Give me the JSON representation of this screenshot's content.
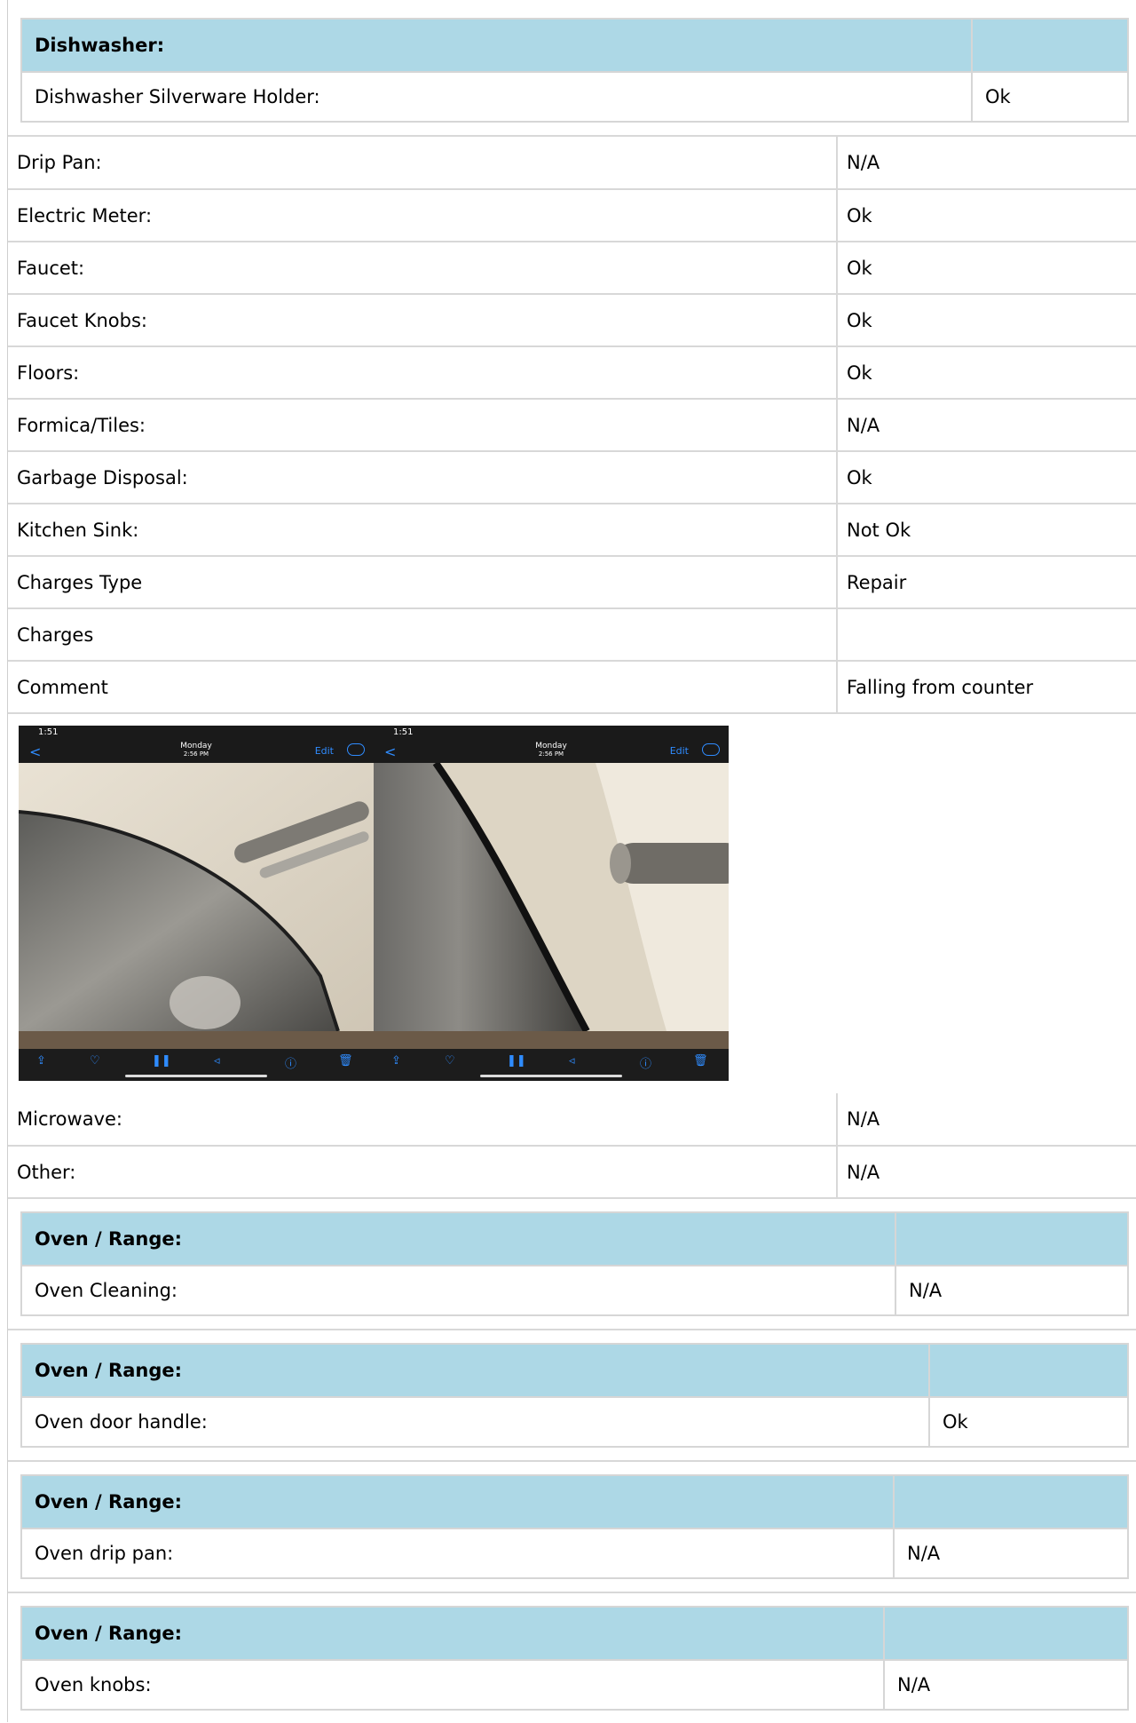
{
  "dishwasher_group": {
    "header": "Dishwasher:",
    "item_label": "Dishwasher Silverware Holder:",
    "item_value": "Ok"
  },
  "rows_a": [
    {
      "label": "Drip Pan:",
      "value": "N/A"
    },
    {
      "label": "Electric Meter:",
      "value": "Ok"
    },
    {
      "label": "Faucet:",
      "value": "Ok"
    },
    {
      "label": "Faucet Knobs:",
      "value": "Ok"
    },
    {
      "label": "Floors:",
      "value": "Ok"
    },
    {
      "label": "Formica/Tiles:",
      "value": "N/A"
    },
    {
      "label": "Garbage Disposal:",
      "value": "Ok"
    },
    {
      "label": "Kitchen Sink:",
      "value": "Not Ok"
    },
    {
      "label": "Charges Type",
      "value": "Repair"
    },
    {
      "label": "Charges",
      "value": ""
    },
    {
      "label": "Comment",
      "value": "Falling from counter"
    }
  ],
  "photo": {
    "left": {
      "time": "1:51",
      "day": "Monday",
      "clock": "2:56 PM",
      "edit": "Edit",
      "back": "<"
    },
    "right": {
      "time": "1:51",
      "day": "Monday",
      "clock": "2:56 PM",
      "edit": "Edit",
      "back": "<"
    }
  },
  "rows_b": [
    {
      "label": "Microwave:",
      "value": "N/A"
    },
    {
      "label": "Other:",
      "value": "N/A"
    }
  ],
  "oven_groups": [
    {
      "header": "Oven / Range:",
      "item_label": "Oven Cleaning:",
      "item_value": "N/A"
    },
    {
      "header": "Oven / Range:",
      "item_label": "Oven door handle:",
      "item_value": "Ok"
    },
    {
      "header": "Oven / Range:",
      "item_label": "Oven drip pan:",
      "item_value": "N/A"
    },
    {
      "header": "Oven / Range:",
      "item_label": "Oven knobs:",
      "item_value": "N/A"
    }
  ]
}
